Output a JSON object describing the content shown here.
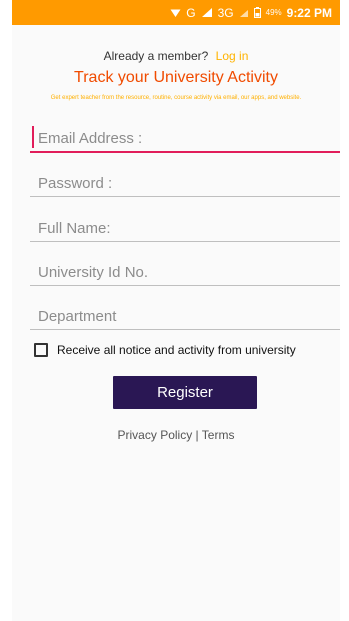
{
  "status_bar": {
    "network_letter": "G",
    "network_3g": "3G",
    "battery": "49%",
    "time": "9:22 PM"
  },
  "login_prompt": {
    "text": "Already a member?",
    "link": "Log in"
  },
  "header": {
    "title": "Track your University Activity",
    "subtitle": "Get expert teacher from the resource, routine, course activity via email, our apps, and website."
  },
  "fields": [
    {
      "placeholder": "Email Address :"
    },
    {
      "placeholder": "Password :"
    },
    {
      "placeholder": "Full Name:"
    },
    {
      "placeholder": "University Id No."
    },
    {
      "placeholder": "Department"
    }
  ],
  "checkbox": {
    "label": "Receive all notice and activity from university",
    "checked": false
  },
  "register_button": "Register",
  "footer": {
    "privacy": "Privacy Policy",
    "separator": "|",
    "terms": "Terms"
  },
  "colors": {
    "status_bar": "#ff9a00",
    "title": "#f04b00",
    "accent_yellow": "#ffb000",
    "active_field": "#e11d5a",
    "button": "#2a1754"
  },
  "icons": {
    "wifi": "wifi-icon",
    "signal": "signal-icon",
    "battery": "battery-icon"
  }
}
